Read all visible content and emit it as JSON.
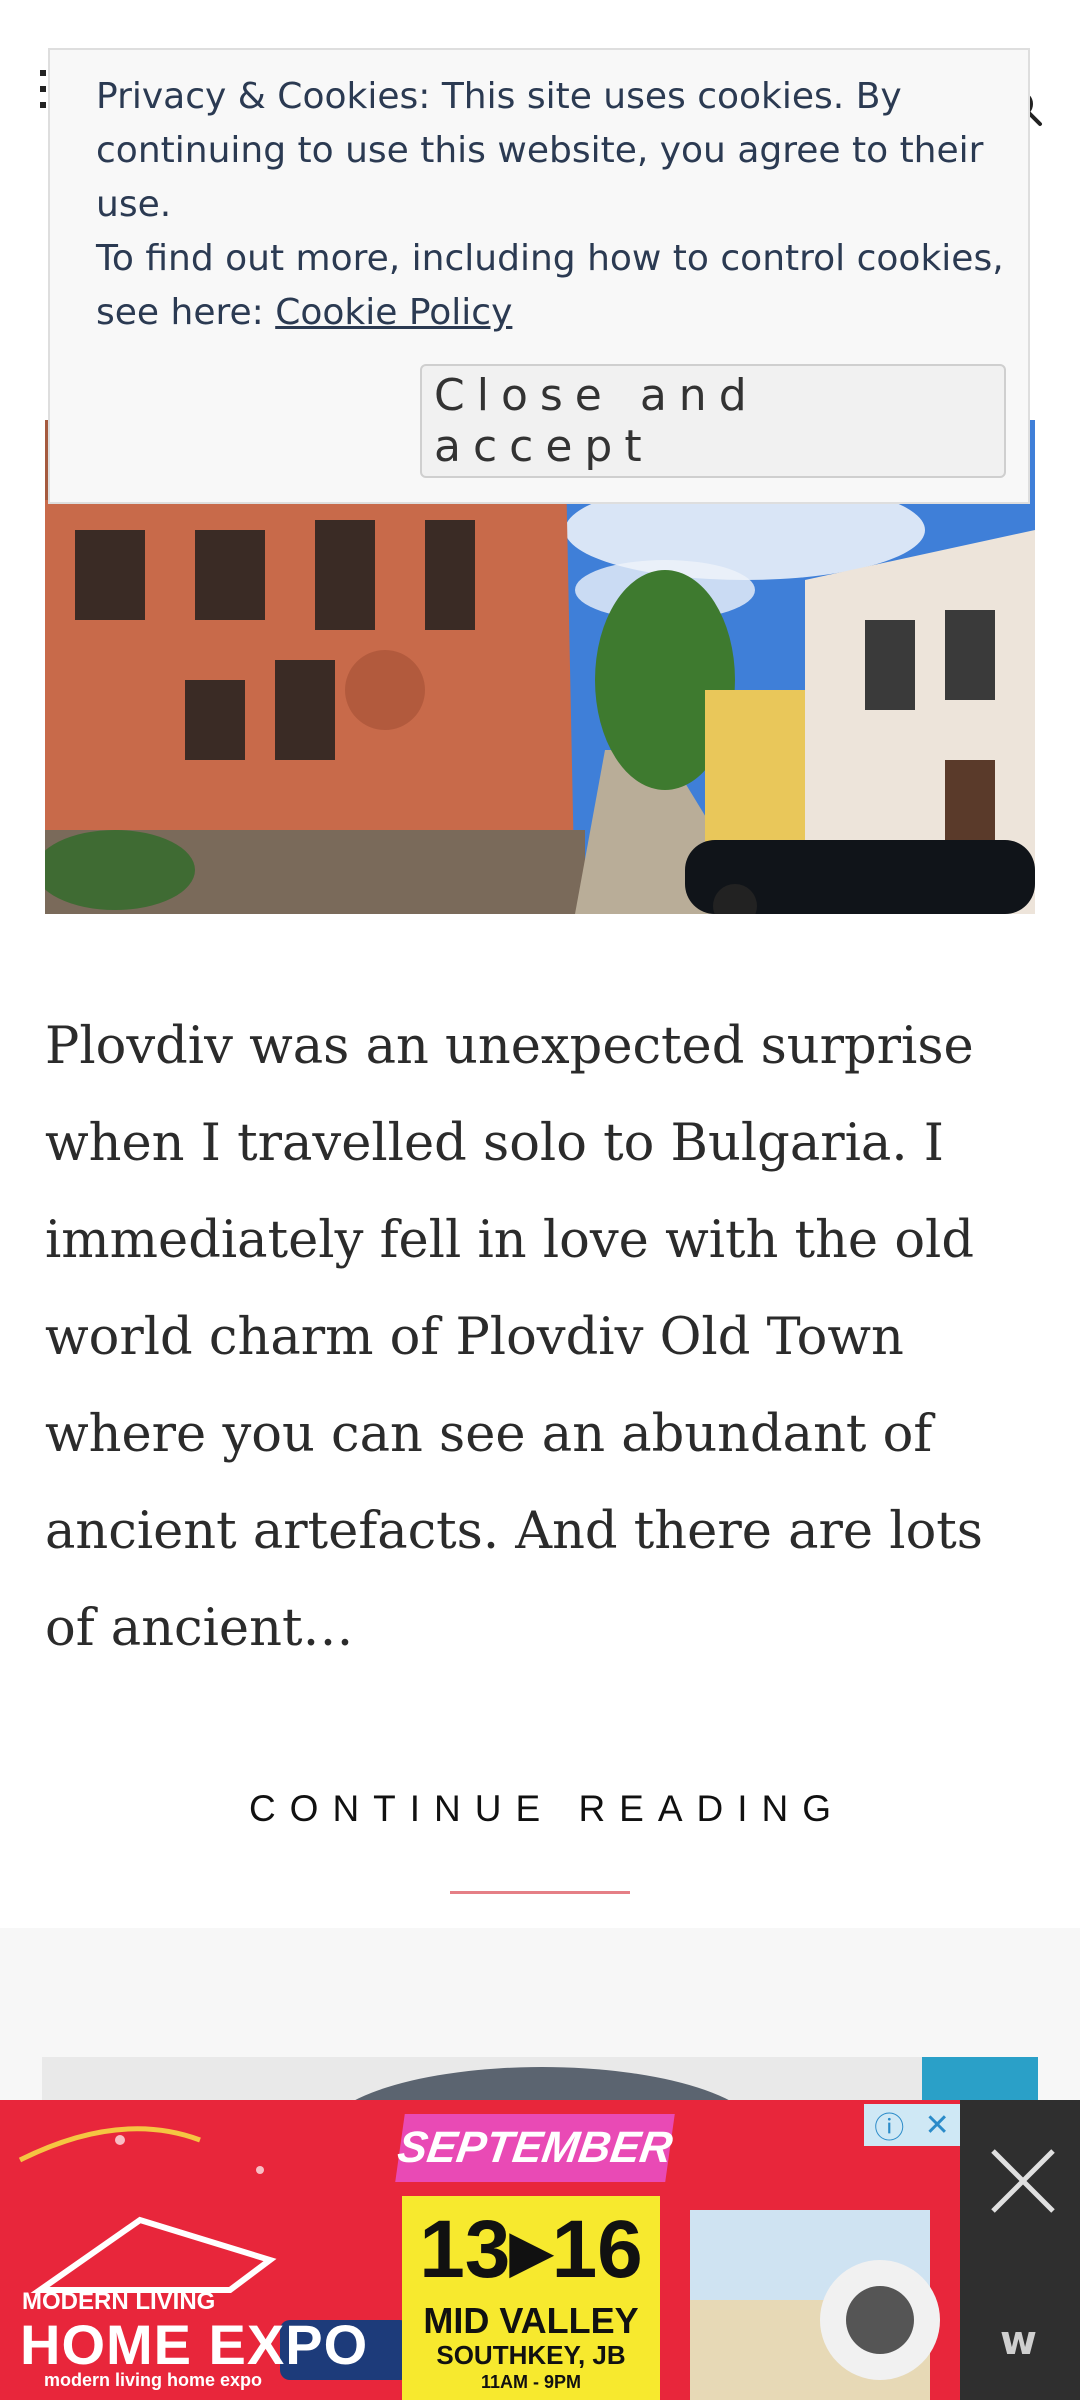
{
  "header": {
    "menu_icon": "menu-dots-icon",
    "search_icon": "search-icon"
  },
  "cookie_banner": {
    "line1": "Privacy & Cookies: This site uses cookies. By continuing to use this website, you agree to their use.",
    "line2_prefix": "To find out more, including how to control cookies, see here: ",
    "policy_link": "Cookie Policy",
    "accept_button": "Close and accept"
  },
  "article": {
    "excerpt": "Plovdiv was an unexpected surprise when I travelled solo to Bulgaria. I immediately fell in love with the old world charm of Plovdiv Old Town where you can see an abundant of ancient artefacts. And there are lots of ancient…",
    "continue_label": "CONTINUE READING"
  },
  "ad": {
    "logo_small": "MODERN LIVING",
    "logo_big": "HOME EXPO",
    "social": "modern living home expo",
    "month": "SEPTEMBER",
    "days": "13▸16",
    "venue": "MID VALLEY",
    "location": "SOUTHKEY, JB",
    "time": "11AM - 9PM",
    "info_icon": "info-icon",
    "close_icon": "close-icon",
    "brand": "w"
  },
  "colors": {
    "accent_underline": "#e57f86",
    "ad_red": "#e8263b",
    "ad_yellow": "#f7e92e",
    "ad_pink": "#e94ab5",
    "cookie_text": "#2b3a52"
  }
}
